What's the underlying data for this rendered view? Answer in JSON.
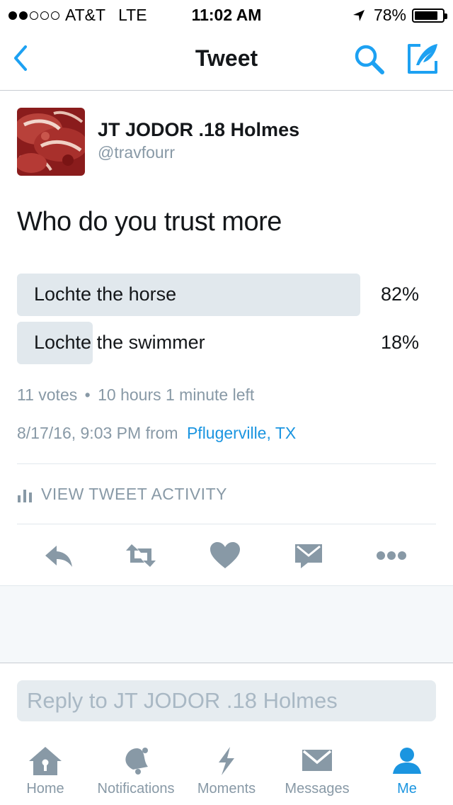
{
  "status_bar": {
    "carrier": "AT&T",
    "network": "LTE",
    "time": "11:02 AM",
    "battery": "78%",
    "battery_level": 0.78,
    "signal_bars": 2
  },
  "nav": {
    "title": "Tweet",
    "back_icon": "chevron-left-icon",
    "search_icon": "search-icon",
    "compose_icon": "compose-tweet-icon",
    "accent": "#1da1f2"
  },
  "tweet": {
    "display_name": "JT JODOR .18 Holmes",
    "handle": "@travfourr",
    "text": "Who do you trust more",
    "poll": {
      "options": [
        {
          "label": "Lochte the horse",
          "percent_text": "82%",
          "percent": 82
        },
        {
          "label": "Lochte the swimmer",
          "percent_text": "18%",
          "percent": 18
        }
      ],
      "votes": "11 votes",
      "separator": "•",
      "time_left": "10 hours 1 minute left"
    },
    "timestamp": "8/17/16, 9:03 PM",
    "from_label": "from",
    "location": "Pflugerville, TX"
  },
  "activity": {
    "label": "VIEW TWEET ACTIVITY"
  },
  "actions": [
    "reply-icon",
    "retweet-icon",
    "like-icon",
    "direct-message-icon",
    "more-icon"
  ],
  "reply": {
    "placeholder": "Reply to JT JODOR .18 Holmes"
  },
  "tabs": [
    {
      "label": "Home",
      "icon": "home-icon"
    },
    {
      "label": "Notifications",
      "icon": "bell-icon"
    },
    {
      "label": "Moments",
      "icon": "lightning-icon"
    },
    {
      "label": "Messages",
      "icon": "envelope-icon"
    },
    {
      "label": "Me",
      "icon": "person-icon",
      "active": true
    }
  ],
  "colors": {
    "link": "#1b95e0",
    "muted": "#8899a6",
    "poll_bar": "#e1e8ed",
    "text": "#14171a"
  }
}
